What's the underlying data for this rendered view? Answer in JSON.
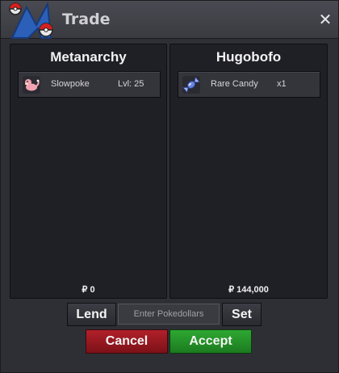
{
  "window": {
    "title": "Trade",
    "close_label": "✕"
  },
  "left_panel": {
    "player": "Metanarchy",
    "item": {
      "name": "Slowpoke",
      "extra": "Lvl: 25",
      "icon": "slowpoke-icon"
    },
    "money": "₽ 0"
  },
  "right_panel": {
    "player": "Hugobofo",
    "item": {
      "name": "Rare Candy",
      "extra": "x1",
      "icon": "rare-candy-icon"
    },
    "money": "₽ 144,000"
  },
  "controls": {
    "lend_label": "Lend",
    "money_placeholder": "Enter Pokedollars",
    "set_label": "Set",
    "cancel_label": "Cancel",
    "accept_label": "Accept"
  },
  "colors": {
    "cancel": "#b1202a",
    "accept": "#2ea832",
    "panel_bg": "#1f1f26"
  }
}
